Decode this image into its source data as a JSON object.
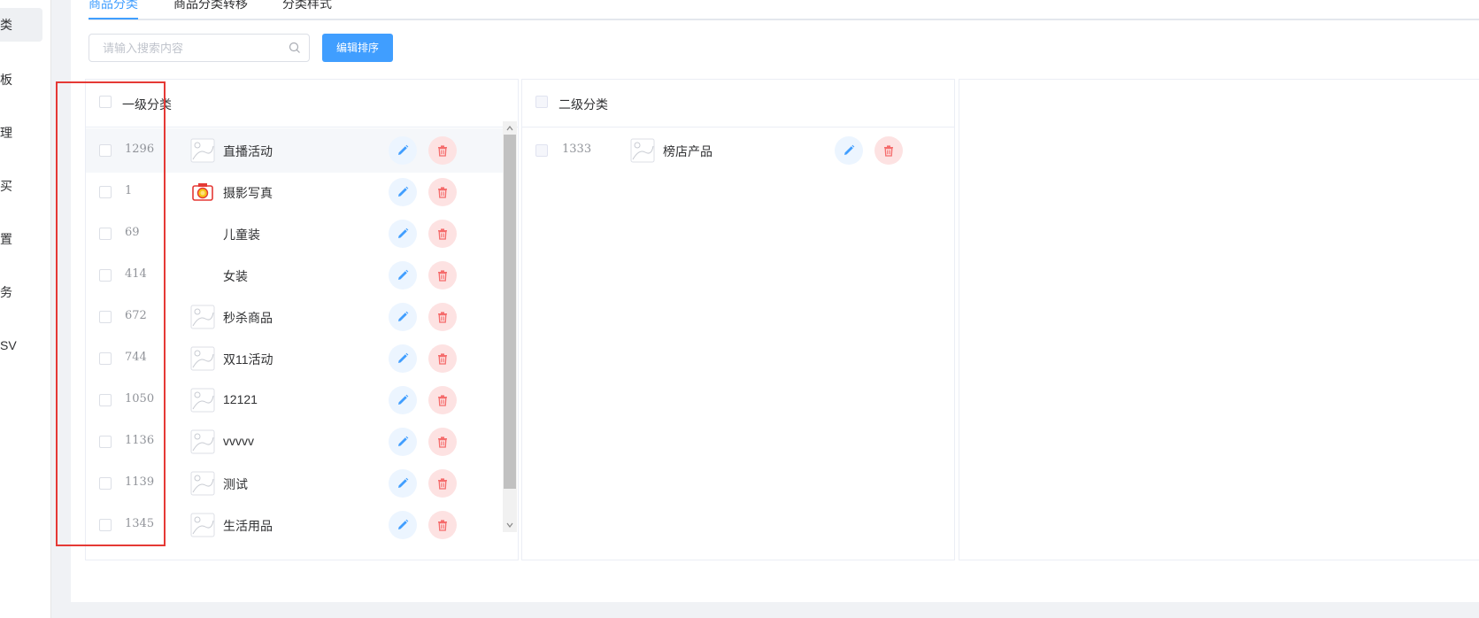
{
  "sidebar": {
    "items": [
      {
        "label": "类",
        "active": true
      },
      {
        "label": "板"
      },
      {
        "label": "理"
      },
      {
        "label": "买"
      },
      {
        "label": "置"
      },
      {
        "label": "务"
      },
      {
        "label": "SV"
      }
    ]
  },
  "tabs": [
    {
      "label": "商品分类",
      "active": true
    },
    {
      "label": "商品分类转移"
    },
    {
      "label": "分类样式"
    }
  ],
  "toolbar": {
    "search_placeholder": "请输入搜索内容",
    "search_value": "",
    "sort_button": "编辑排序"
  },
  "level1": {
    "header": "一级分类",
    "rows": [
      {
        "id": "1296",
        "name": "直播活动",
        "icon": "image-placeholder-icon",
        "hover": true
      },
      {
        "id": "1",
        "name": "摄影写真",
        "icon": "camera-icon"
      },
      {
        "id": "69",
        "name": "儿童装",
        "icon": "none"
      },
      {
        "id": "414",
        "name": "女装",
        "icon": "none"
      },
      {
        "id": "672",
        "name": "秒杀商品",
        "icon": "image-placeholder-icon"
      },
      {
        "id": "744",
        "name": "双11活动",
        "icon": "image-placeholder-icon"
      },
      {
        "id": "1050",
        "name": "12121",
        "icon": "image-placeholder-icon"
      },
      {
        "id": "1136",
        "name": "vvvvv",
        "icon": "image-placeholder-icon"
      },
      {
        "id": "1139",
        "name": "测试",
        "icon": "image-placeholder-icon"
      },
      {
        "id": "1345",
        "name": "生活用品",
        "icon": "image-placeholder-icon"
      }
    ]
  },
  "level2": {
    "header": "二级分类",
    "rows": [
      {
        "id": "1333",
        "name": "榜店产品",
        "icon": "image-placeholder-icon"
      }
    ]
  },
  "colors": {
    "accent": "#409eff",
    "danger": "#f56c6c",
    "highlight_box": "#e53935"
  }
}
